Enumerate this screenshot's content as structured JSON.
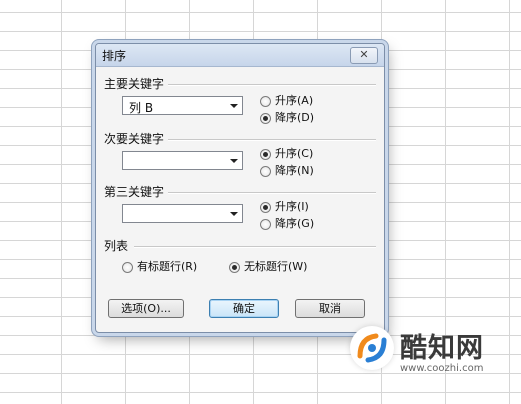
{
  "dialog": {
    "title": "排序",
    "close_symbol": "✕",
    "primary_key": {
      "label": "主要关键字",
      "value": "列 B",
      "asc_label": "升序(A)",
      "desc_label": "降序(D)",
      "selected": "desc"
    },
    "secondary_key": {
      "label": "次要关键字",
      "value": "",
      "asc_label": "升序(C)",
      "desc_label": "降序(N)",
      "selected": "asc"
    },
    "tertiary_key": {
      "label": "第三关键字",
      "value": "",
      "asc_label": "升序(I)",
      "desc_label": "降序(G)",
      "selected": "asc"
    },
    "list_section": {
      "label": "列表",
      "has_header_label": "有标题行(R)",
      "no_header_label": "无标题行(W)",
      "selected": "no_header"
    },
    "buttons": {
      "options": "选项(O)...",
      "ok": "确定",
      "cancel": "取消"
    }
  },
  "watermark": {
    "name": "酷知网",
    "url": "www.coozhi.com",
    "colors": {
      "orange": "#f08a1c",
      "blue": "#2a7fd4"
    }
  }
}
